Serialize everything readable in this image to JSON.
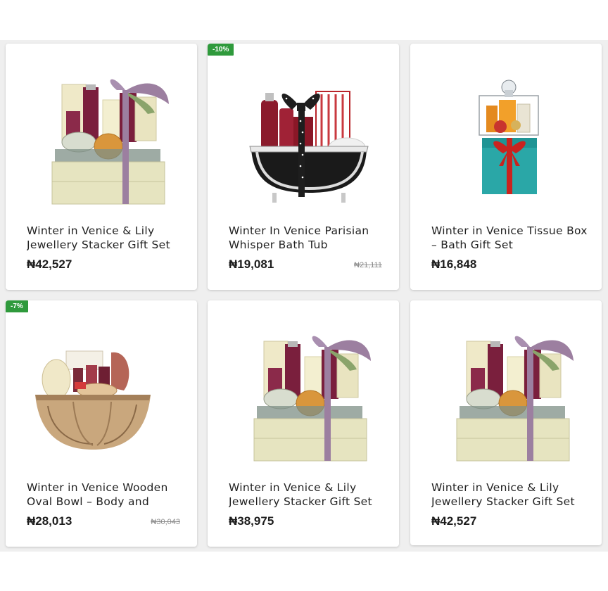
{
  "products": [
    {
      "title": "Winter in Venice & Lily Jewellery Stacker Gift Set",
      "price": "₦42,527",
      "old_price": "",
      "badge": "",
      "image": "lily-stacker-gift-box"
    },
    {
      "title": "Winter In Venice Parisian Whisper Bath Tub",
      "price": "₦19,081",
      "old_price": "₦21,111",
      "badge": "-10%",
      "image": "bath-tub-gift"
    },
    {
      "title": "Winter in Venice Tissue Box – Bath Gift Set",
      "price": "₦16,848",
      "old_price": "",
      "badge": "",
      "image": "teal-tissue-box-gift"
    },
    {
      "title": "Winter in Venice Wooden Oval Bowl – Body and",
      "price": "₦28,013",
      "old_price": "₦30,043",
      "badge": "-7%",
      "image": "wooden-oval-bowl-gift"
    },
    {
      "title": "Winter in Venice & Lily Jewellery Stacker Gift Set",
      "price": "₦38,975",
      "old_price": "",
      "badge": "",
      "image": "lily-stacker-gift-box"
    },
    {
      "title": "Winter in Venice & Lily Jewellery Stacker Gift Set",
      "price": "₦42,527",
      "old_price": "",
      "badge": "",
      "image": "lily-stacker-gift-box"
    }
  ],
  "colors": {
    "badge": "#2f9a3c",
    "background": "#efefef",
    "card": "#ffffff"
  }
}
